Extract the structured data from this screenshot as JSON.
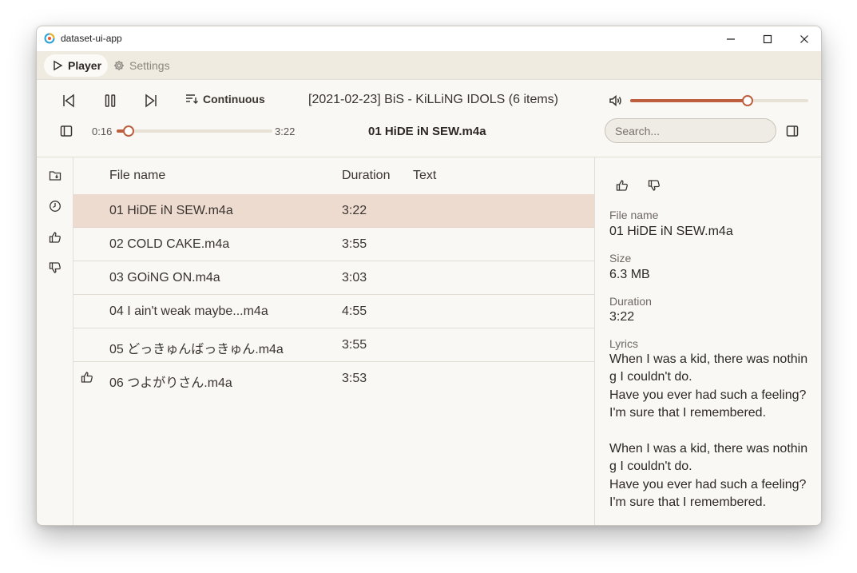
{
  "window": {
    "title": "dataset-ui-app"
  },
  "tabs": [
    {
      "label": "Player",
      "active": true
    },
    {
      "label": "Settings",
      "active": false
    }
  ],
  "player": {
    "repeat_mode_label": "Continuous",
    "playlist_title": "[2021-02-23] BiS - KiLLiNG IDOLS (6 items)",
    "now_playing": "01 HiDE iN SEW.m4a",
    "elapsed": "0:16",
    "total": "3:22",
    "progress_fraction": 0.079,
    "volume_fraction": 0.66
  },
  "search": {
    "placeholder": "Search..."
  },
  "list": {
    "columns": [
      "File name",
      "Duration",
      "Text"
    ],
    "rows": [
      {
        "file_name": "01 HiDE iN SEW.m4a",
        "duration": "3:22",
        "text": "",
        "liked": false,
        "selected": true
      },
      {
        "file_name": "02 COLD CAKE.m4a",
        "duration": "3:55",
        "text": "",
        "liked": false,
        "selected": false
      },
      {
        "file_name": "03 GOiNG ON.m4a",
        "duration": "3:03",
        "text": "",
        "liked": false,
        "selected": false
      },
      {
        "file_name": "04 I ain't weak maybe...m4a",
        "duration": "4:55",
        "text": "",
        "liked": false,
        "selected": false
      },
      {
        "file_name": "05 どっきゅんばっきゅん.m4a",
        "duration": "3:55",
        "text": "",
        "liked": false,
        "selected": false
      },
      {
        "file_name": "06 つよがりさん.m4a",
        "duration": "3:53",
        "text": "",
        "liked": true,
        "selected": false
      }
    ]
  },
  "detail": {
    "file_name_label": "File name",
    "file_name": "01 HiDE iN SEW.m4a",
    "size_label": "Size",
    "size": "6.3 MB",
    "duration_label": "Duration",
    "duration": "3:22",
    "lyrics_label": "Lyrics",
    "lyrics": "When I was a kid, there was nothing I couldn't do.\nHave you ever had such a feeling?\nI'm sure that I remembered.\n\nWhen I was a kid, there was nothing I couldn't do.\nHave you ever had such a feeling?\nI'm sure that I remembered."
  },
  "colors": {
    "accent": "#bd5e3f",
    "selected_row": "#eddbd0",
    "tabbar": "#efebe0",
    "background": "#f9f8f4"
  },
  "icons": {
    "rail": [
      "folder-icon",
      "history-icon",
      "thumbs-up-icon",
      "thumbs-down-icon"
    ]
  }
}
